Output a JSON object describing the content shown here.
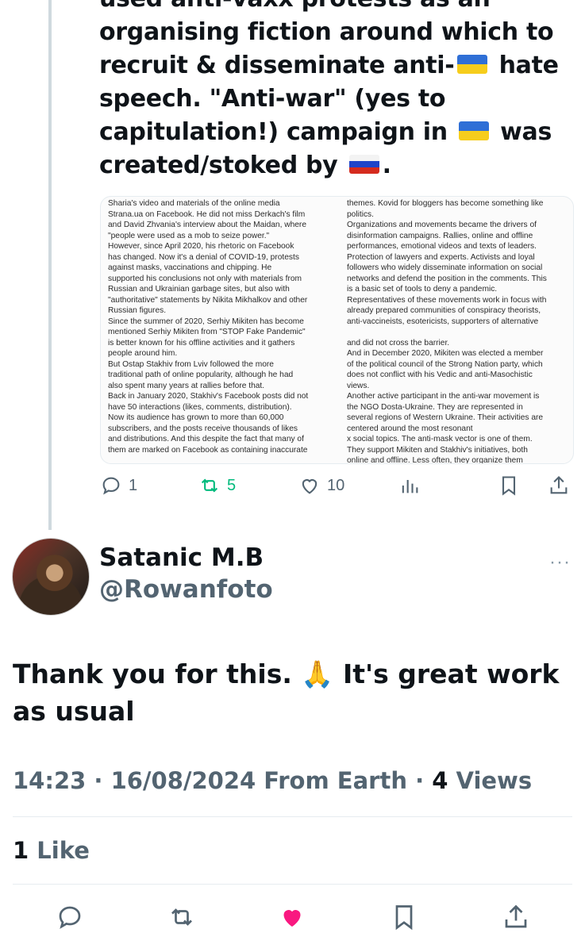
{
  "previous_tweet": {
    "lines": [
      "used anti-vaxx protests as an",
      "organising fiction around which to",
      "recruit & disseminate anti-",
      " hate",
      "speech. \"Anti-war\" (yes to",
      "capitulation!) campaign in ",
      " was",
      "created/stoked by ",
      "."
    ],
    "flags": {
      "ukraine": "ukraine-flag",
      "russia": "russia-flag"
    },
    "image_left_column": [
      "Sharia's video and materials of the online media",
      "Strana.ua on Facebook. He did not miss Derkach's film",
      "and David Zhvania's interview about the Maidan, where",
      "\"people were used as a mob to seize power.\"",
      "However, since April 2020, his rhetoric on Facebook",
      "has changed. Now it's a denial of COVID-19, protests",
      "against masks, vaccinations and chipping. He",
      "supported his conclusions not only with materials from",
      "Russian and Ukrainian garbage sites, but also with",
      "\"authoritative\" statements by Nikita Mikhalkov and other",
      "Russian figures.",
      "Since the summer of 2020, Serhiy Mikiten has become",
      "mentioned Serhiy Mikiten from \"STOP Fake Pandemic\"",
      "is better known for his offline activities and it gathers",
      "people around him.",
      "But Ostap Stakhiv from Lviv followed the more",
      "traditional path of online popularity, although he had",
      "also spent many years at rallies before that.",
      "Back in January 2020, Stakhiv's Facebook posts did not",
      "have 50 interactions (likes, comments, distribution).",
      "Now its audience has grown to more than 60,000",
      "subscribers, and the posts receive thousands of likes",
      "and distributions. And this despite the fact that many of",
      "them are marked on Facebook as containing inaccurate"
    ],
    "image_right_column": [
      "themes. Kovid for bloggers has become something like",
      "politics.",
      "Organizations and movements became the drivers of",
      "disinformation campaigns. Rallies, online and offline",
      "performances, emotional videos and texts of leaders.",
      "Protection of lawyers and experts. Activists and loyal",
      "followers who widely disseminate information on social",
      "networks and defend the position in the comments. This",
      "is a basic set of tools to deny a pandemic.",
      "Representatives of these movements work in focus with",
      "already prepared communities of conspiracy theorists,",
      "anti-vaccineists, esotericists, supporters of alternative",
      "",
      "and did not cross the barrier.",
      "And in December 2020, Mikiten was elected a member",
      "of the political council of the Strong Nation party, which",
      "does not conflict with his Vedic and anti-Masochistic",
      "views.",
      "Another active participant in the anti-war movement is",
      "the NGO Dosta-Ukraine. They are represented in",
      "several regions of Western Ukraine. Their activities are",
      "centered around the most resonant",
      "x social topics. The anti-mask vector is one of them.",
      "They support Mikiten and Stakhiv's initiatives, both",
      "online and offline. Less often, they organize them"
    ],
    "actions": {
      "replies": "1",
      "retweets": "5",
      "likes": "10"
    }
  },
  "reply": {
    "display_name": "Satanic M.B",
    "handle": "@Rowanfoto",
    "more": "···",
    "text": "Thank you for this. 🙏 It's great work as usual",
    "time": "14:23",
    "date": "16/08/2024",
    "source": "From Earth",
    "views_count": "4",
    "views_label": "Views",
    "likes_count": "1",
    "likes_label": "Like"
  },
  "colors": {
    "text": "#0f1419",
    "muted": "#536471",
    "retweet_green": "#00ba7c",
    "like_pink": "#f91880",
    "divider": "#e6ecf0"
  }
}
